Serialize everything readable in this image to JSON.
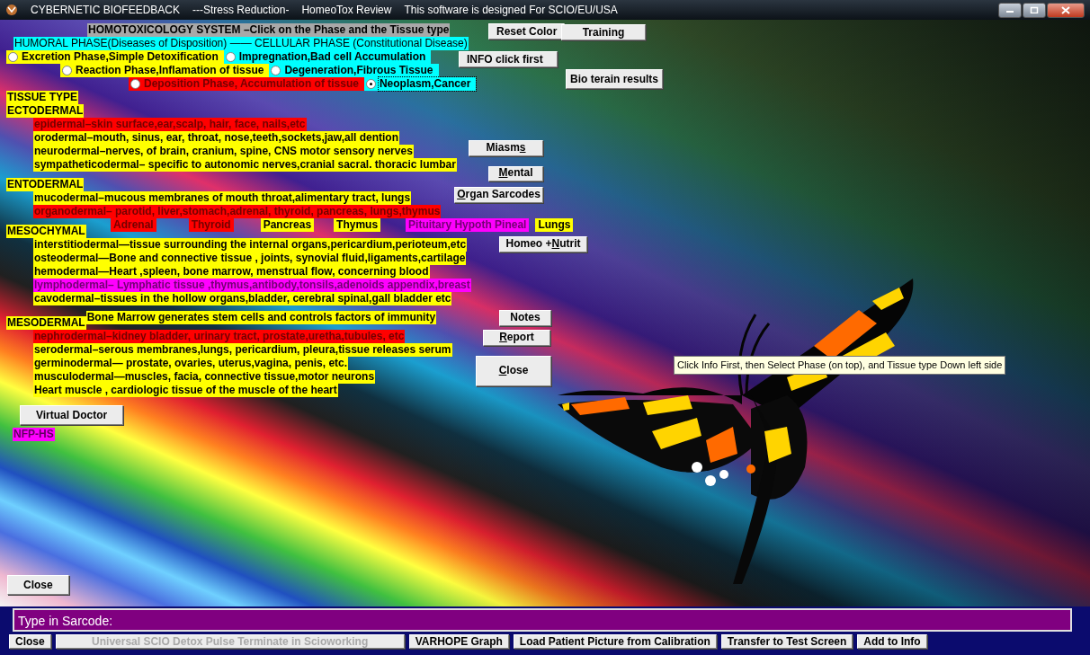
{
  "window": {
    "title_parts": [
      "CYBERNETIC BIOFEEDBACK",
      "---Stress Reduction-",
      "HomeoTox Review",
      "This software is designed For SCIO/EU/USA"
    ]
  },
  "header": "HOMOTOXICOLOGY SYSTEM –Click on the Phase and the Tissue type",
  "reset_button": "Reset Color",
  "training_button": "Training",
  "phase_heading": "HUMORAL PHASE(Diseases of Disposition) —— CELLULAR PHASE (Constitutional Disease)",
  "phase_rows": [
    [
      {
        "label": "Excretion Phase,Simple Detoxification",
        "color": "#ffff00",
        "selected": false
      },
      {
        "label": "Impregnation,Bad cell Accumulation",
        "color": "#00ffff",
        "selected": false
      }
    ],
    [
      {
        "label": "Reaction Phase,Inflamation of tissue",
        "color": "#ffff00",
        "selected": false
      },
      {
        "label": "Degeneration,Fibrous Tissue",
        "color": "#00ffff",
        "selected": false
      }
    ],
    [
      {
        "label": "Deposition Phase, Accumulation of tissue",
        "color": "#ff0000",
        "selected": false
      },
      {
        "label": "Neoplasm,Cancer",
        "color": "#00ffff",
        "selected": true
      }
    ]
  ],
  "info_button": "INFO click first",
  "bio_terrain_button": "Bio terain results",
  "tissue_type": "TISSUE TYPE",
  "tissue_groups": [
    {
      "name": "ECTODERMAL",
      "items": [
        {
          "text": "epidermal–skin surface,ear,scalp, hair, face, nails,etc",
          "color": "#ff0000"
        },
        {
          "text": "orodermal–mouth, sinus, ear, throat, nose,teeth,sockets,jaw,all dention",
          "color": "#ffff00"
        },
        {
          "text": "neurodermal–nerves, of brain, cranium, spine, CNS motor sensory nerves",
          "color": "#ffff00"
        },
        {
          "text": "sympatheticodermal– specific to autonomic nerves,cranial sacral. thoracic lumbar",
          "color": "#ffff00"
        }
      ]
    },
    {
      "name": "ENTODERMAL",
      "items": [
        {
          "text": "mucodermal–mucous membranes of mouth throat,alimentary tract, lungs",
          "color": "#ffff00"
        },
        {
          "text": "organodermal– parotid, liver,stomach,adrenal, thyroid, pancreas, lungs,thymus",
          "color": "#ff0000"
        }
      ],
      "organs": [
        {
          "label": "Adrenal",
          "color": "#ff0000"
        },
        {
          "label": "Thyroid",
          "color": "#ff0000"
        },
        {
          "label": "Pancreas",
          "color": "#ffff00"
        },
        {
          "label": "Thymus",
          "color": "#ffff00"
        },
        {
          "label": "Pituitary Hypoth Pineal",
          "color": "#ff00ff"
        },
        {
          "label": "Lungs",
          "color": "#ffff00"
        }
      ]
    },
    {
      "name": "MESOCHYMAL",
      "items": [
        {
          "text": "interstitiodermal—tissue surrounding the internal organs,pericardium,perioteum,etc",
          "color": "#ffff00"
        },
        {
          "text": "osteodermal—Bone and connective tissue , joints, synovial fluid,ligaments,cartilage",
          "color": "#ffff00"
        },
        {
          "text": "hemodermal—Heart ,spleen, bone marrow, menstrual flow, concerning blood",
          "color": "#ffff00"
        },
        {
          "text": "lymphodermal– Lymphatic tissue ,thymus,antibody,tonsils,adenoids appendix,breast",
          "color": "#ff00ff"
        },
        {
          "text": "cavodermal–tissues in the hollow organs,bladder, cerebral spinal,gall bladder etc",
          "color": "#ffff00"
        }
      ]
    },
    {
      "name": "MESODERMAL",
      "note": "Bone Marrow generates stem cells and controls factors of immunity",
      "items": [
        {
          "text": "nephrodermal–kidney bladder, urinary tract, prostate,uretha,tubules, etc",
          "color": "#ff0000"
        },
        {
          "text": "serodermal–serous membranes,lungs, pericardium, pleura,tissue releases serum",
          "color": "#ffff00"
        },
        {
          "text": "germinodermal— prostate, ovaries, uterus,vagina, penis, etc.",
          "color": "#ffff00"
        },
        {
          "text": "musculodermal—muscles, facia, connective tissue,motor neurons",
          "color": "#ffff00"
        },
        {
          "text": "Heart muscle , cardiologic tissue of the muscle of the heart",
          "color": "#ffff00"
        }
      ]
    }
  ],
  "side_buttons": [
    {
      "before": "Miasm",
      "key": "s"
    },
    {
      "key": "M",
      "after": "ental"
    },
    {
      "key": "O",
      "after": "rgan Sarcodes"
    },
    {
      "before": "Homeo +",
      "key": "N",
      "after": "utrit"
    },
    {
      "before": "Notes"
    },
    {
      "key": "R",
      "after": "eport"
    },
    {
      "key": "C",
      "after": "lose"
    }
  ],
  "virtual_doctor_button": "Virtual Doctor",
  "nfp_label": "NFP-HS",
  "tooltip": "Click Info First, then Select Phase (on top), and Tissue type Down left side",
  "close_button": "Close",
  "sarcode_field": {
    "value": "Type in Sarcode:"
  },
  "bottom_buttons": [
    {
      "label": "Close",
      "disabled": false
    },
    {
      "label": "Universal SCIO Detox Pulse Terminate in Scioworking",
      "disabled": true
    },
    {
      "label": "VARHOPE Graph",
      "disabled": false
    },
    {
      "label": "Load Patient Picture from Calibration",
      "disabled": false
    },
    {
      "label": "Transfer to Test Screen",
      "disabled": false
    },
    {
      "label": "Add to Info",
      "disabled": false
    }
  ]
}
